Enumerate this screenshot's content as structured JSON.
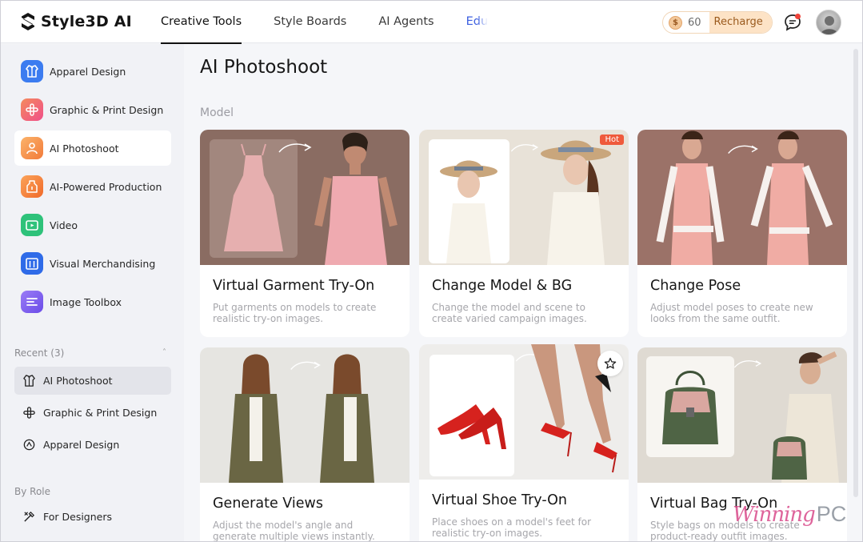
{
  "header": {
    "logo_text": "Style3D AI",
    "nav": [
      "Creative Tools",
      "Style Boards",
      "AI Agents",
      "Edu"
    ],
    "credits": "60",
    "coin_symbol": "$",
    "recharge_label": "Recharge"
  },
  "sidebar": {
    "items": [
      {
        "label": "Apparel Design",
        "icon": "apparel-icon",
        "color": "#3c7cf0"
      },
      {
        "label": "Graphic & Print Design",
        "icon": "graphic-print-icon",
        "color": "#f4608a"
      },
      {
        "label": "AI Photoshoot",
        "icon": "photoshoot-icon",
        "color": "#f08a3c"
      },
      {
        "label": "AI-Powered Production",
        "icon": "production-icon",
        "color": "#f47a32"
      },
      {
        "label": "Video",
        "icon": "video-icon",
        "color": "#2ec27a"
      },
      {
        "label": "Visual Merchandising",
        "icon": "merchandising-icon",
        "color": "#2f6be8"
      },
      {
        "label": "Image Toolbox",
        "icon": "toolbox-icon",
        "color": "#7b5cf0"
      }
    ],
    "recent_title": "Recent (3)",
    "recent": [
      {
        "label": "AI Photoshoot",
        "icon": "photoshoot-outline-icon"
      },
      {
        "label": "Graphic & Print Design",
        "icon": "graphic-print-outline-icon"
      },
      {
        "label": "Apparel Design",
        "icon": "apparel-outline-icon"
      }
    ],
    "role_title": "By Role",
    "roles": [
      {
        "label": "For Designers",
        "icon": "designer-tools-icon"
      }
    ]
  },
  "main": {
    "title": "AI Photoshoot",
    "group_label": "Model",
    "cards": [
      {
        "title": "Virtual Garment Try-On",
        "desc": "Put garments on models to create realistic try-on images.",
        "badge": ""
      },
      {
        "title": "Change Model & BG",
        "desc": "Change the model and scene to create varied campaign images.",
        "badge": "Hot"
      },
      {
        "title": "Change Pose",
        "desc": "Adjust model poses to create new looks from the same outfit.",
        "badge": ""
      },
      {
        "title": "Generate Views",
        "desc": "Adjust the model's angle and generate multiple views instantly.",
        "badge": ""
      },
      {
        "title": "Virtual Shoe Try-On",
        "desc": "Place shoes on a model's feet for realistic try-on images.",
        "badge": ""
      },
      {
        "title": "Virtual Bag Try-On",
        "desc": "Style bags on models to create product-ready outfit images.",
        "badge": ""
      }
    ]
  },
  "watermark": {
    "script": "Winning",
    "suffix": "PC"
  }
}
